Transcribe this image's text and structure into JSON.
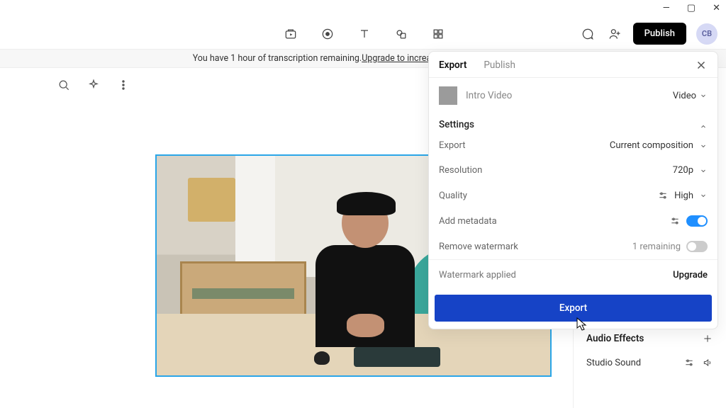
{
  "topbar": {
    "publish_label": "Publish",
    "avatar_initials": "CB"
  },
  "banner": {
    "text_prefix": "You have 1 hour of transcription remaining. ",
    "link_text": "Upgrade to increase your transcription limit."
  },
  "export_panel": {
    "tabs": {
      "export": "Export",
      "publish": "Publish"
    },
    "title": "Intro Video",
    "type_label": "Video",
    "settings_label": "Settings",
    "rows": {
      "export": {
        "label": "Export",
        "value": "Current composition"
      },
      "resolution": {
        "label": "Resolution",
        "value": "720p"
      },
      "quality": {
        "label": "Quality",
        "value": "High"
      },
      "metadata": {
        "label": "Add metadata"
      },
      "watermark": {
        "label": "Remove watermark",
        "remaining": "1 remaining"
      }
    },
    "watermark_row": {
      "status": "Watermark applied",
      "action": "Upgrade"
    },
    "export_button": "Export"
  },
  "side_right": {
    "audio_effects_label": "Audio Effects",
    "studio_sound_label": "Studio Sound"
  }
}
